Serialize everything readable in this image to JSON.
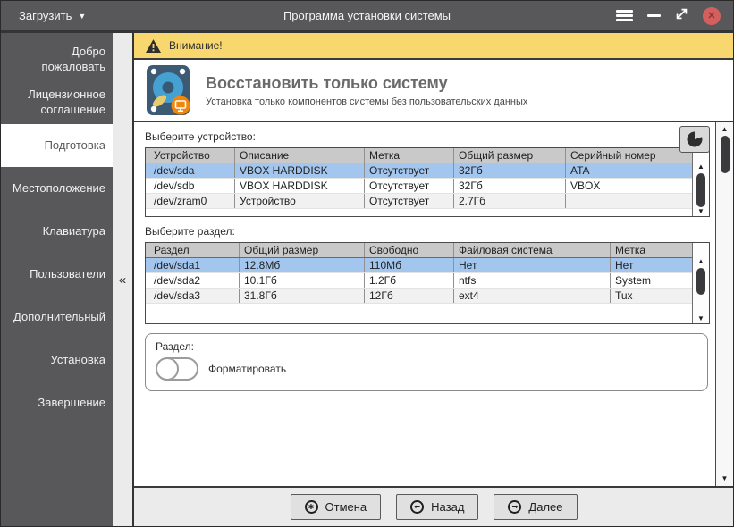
{
  "titlebar": {
    "load_label": "Загрузить",
    "title": "Программа установки системы",
    "icons": [
      "dropdown-caret-icon",
      "hamburger-menu-icon",
      "minimize-icon",
      "maximize-icon",
      "close-icon"
    ],
    "close_glyph": "✕"
  },
  "sidebar": {
    "items": [
      {
        "label": "Добро пожаловать",
        "active": false
      },
      {
        "label": "Лицензионное соглашение",
        "active": false
      },
      {
        "label": "Подготовка",
        "active": true
      },
      {
        "label": "Местоположение",
        "active": false
      },
      {
        "label": "Клавиатура",
        "active": false
      },
      {
        "label": "Пользователи",
        "active": false
      },
      {
        "label": "Дополнительный",
        "active": false
      },
      {
        "label": "Установка",
        "active": false
      },
      {
        "label": "Завершение",
        "active": false
      }
    ],
    "collapse_glyph": "«"
  },
  "warning": {
    "label": "Внимание!",
    "icon": "warning-triangle-icon"
  },
  "header": {
    "title": "Восстановить только систему",
    "subtitle": "Установка только компонентов системы без пользовательских данных",
    "icon": "hard-disk-icon"
  },
  "device_section": {
    "label": "Выберите устройство:",
    "pie_button_icon": "disk-usage-pie-icon",
    "table": {
      "headers": [
        "Устройство",
        "Описание",
        "Метка",
        "Общий размер",
        "Серийный номер"
      ],
      "rows": [
        [
          "/dev/sda",
          "VBOX HARDDISK",
          "Отсутствует",
          "32Гб",
          "ATA"
        ],
        [
          "/dev/sdb",
          "VBOX HARDDISK",
          "Отсутствует",
          "32Гб",
          "VBOX"
        ],
        [
          "/dev/zram0",
          "Устройство",
          "Отсутствует",
          "2.7Гб",
          ""
        ]
      ],
      "selected_row": 0
    }
  },
  "partition_section": {
    "label": "Выберите раздел:",
    "table": {
      "headers": [
        "Раздел",
        "Общий размер",
        "Свободно",
        "Файловая система",
        "Метка"
      ],
      "rows": [
        [
          "/dev/sda1",
          "12.8Мб",
          "110Мб",
          "Нет",
          "Нет"
        ],
        [
          "/dev/sda2",
          "10.1Гб",
          "1.2Гб",
          "ntfs",
          "System"
        ],
        [
          "/dev/sda3",
          "31.8Гб",
          "12Гб",
          "ext4",
          "Tux"
        ]
      ],
      "selected_row": 0
    }
  },
  "partition_options": {
    "group_label": "Раздел:",
    "format_label": "Форматировать",
    "format_enabled": false
  },
  "footer": {
    "buttons": [
      {
        "label": "Отмена",
        "icon": "cancel-icon",
        "glyph": "✱"
      },
      {
        "label": "Назад",
        "icon": "back-icon",
        "glyph": "←"
      },
      {
        "label": "Далее",
        "icon": "next-icon",
        "glyph": "→"
      }
    ]
  },
  "colors": {
    "titlebar_bg": "#58585a",
    "sidebar_bg": "#58585a",
    "warning_bg": "#f7d76e",
    "selection": "#a3c6ee",
    "close_button": "#d45f5f",
    "badge_orange": "#f1860d",
    "disk_blue": "#45a1d2"
  }
}
